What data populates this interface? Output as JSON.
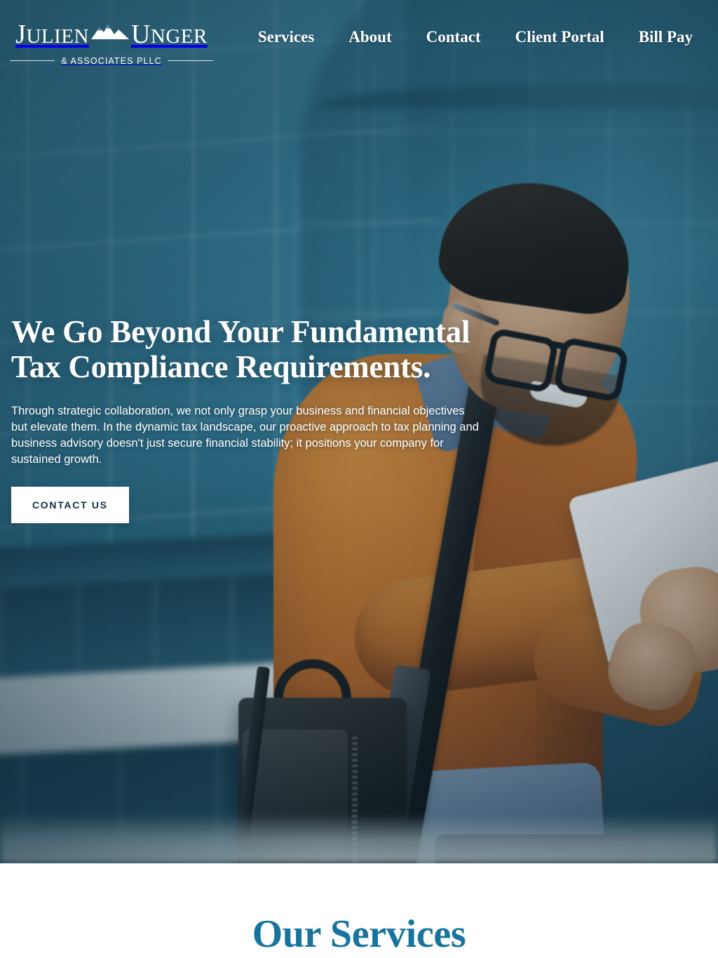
{
  "brand": {
    "name_part1": "Julien",
    "name_part2": "Unger",
    "tagline": "& ASSOCIATES PLLC",
    "logo_icon": "mountain-range-icon",
    "accent_color": "#17749f",
    "cta_text_color": "#12303f"
  },
  "nav": {
    "items": [
      {
        "label": "Services"
      },
      {
        "label": "About"
      },
      {
        "label": "Contact"
      },
      {
        "label": "Client Portal"
      },
      {
        "label": "Bill Pay"
      }
    ]
  },
  "hero": {
    "title": "We Go Beyond Your Fundamental Tax Compliance Requirements.",
    "body": "Through strategic collaboration, we not only grasp your business and financial objectives but elevate them. In the dynamic tax landscape, our proactive approach to tax planning and business advisory doesn't just secure financial stability; it positions your company for sustained growth.",
    "cta_label": "CONTACT US",
    "image_description": "Smiling businessman in an orange sweater and blue shirt holding a white tablet, with a black leather briefcase on a shoulder strap, standing in front of a blurred blue glass office building"
  },
  "services_section": {
    "heading": "Our Services"
  }
}
